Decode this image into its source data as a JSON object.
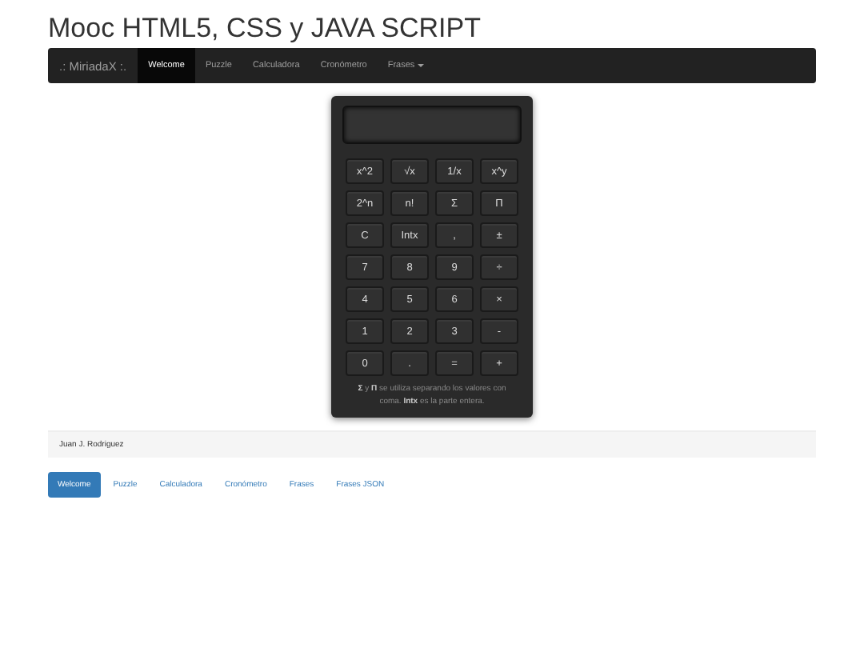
{
  "title": "Mooc HTML5, CSS y JAVA SCRIPT",
  "navbar": {
    "brand": ".: MiriadaX :.",
    "items": [
      {
        "label": "Welcome",
        "selected": true,
        "dropdown": false
      },
      {
        "label": "Puzzle",
        "selected": false,
        "dropdown": false
      },
      {
        "label": "Calculadora",
        "selected": false,
        "dropdown": false
      },
      {
        "label": "Cronómetro",
        "selected": false,
        "dropdown": false
      },
      {
        "label": "Frases",
        "selected": false,
        "dropdown": true
      }
    ]
  },
  "calculator": {
    "keys": [
      "x^2",
      "√x",
      "1/x",
      "x^y",
      "2^n",
      "n!",
      "Σ",
      "Π",
      "C",
      "Intx",
      ",",
      "±",
      "7",
      "8",
      "9",
      "÷",
      "4",
      "5",
      "6",
      "×",
      "1",
      "2",
      "3",
      "-",
      "0",
      ".",
      "=",
      "+"
    ],
    "note": "**Σ** y **Π** se utiliza separando los valores con coma. **Intx** es la parte entera."
  },
  "footer": {
    "author": "Juan J. Rodriguez"
  },
  "pills": [
    {
      "label": "Welcome",
      "selected": true
    },
    {
      "label": "Puzzle",
      "selected": false
    },
    {
      "label": "Calculadora",
      "selected": false
    },
    {
      "label": "Cronómetro",
      "selected": false
    },
    {
      "label": "Frases",
      "selected": false
    },
    {
      "label": "Frases JSON",
      "selected": false
    }
  ]
}
